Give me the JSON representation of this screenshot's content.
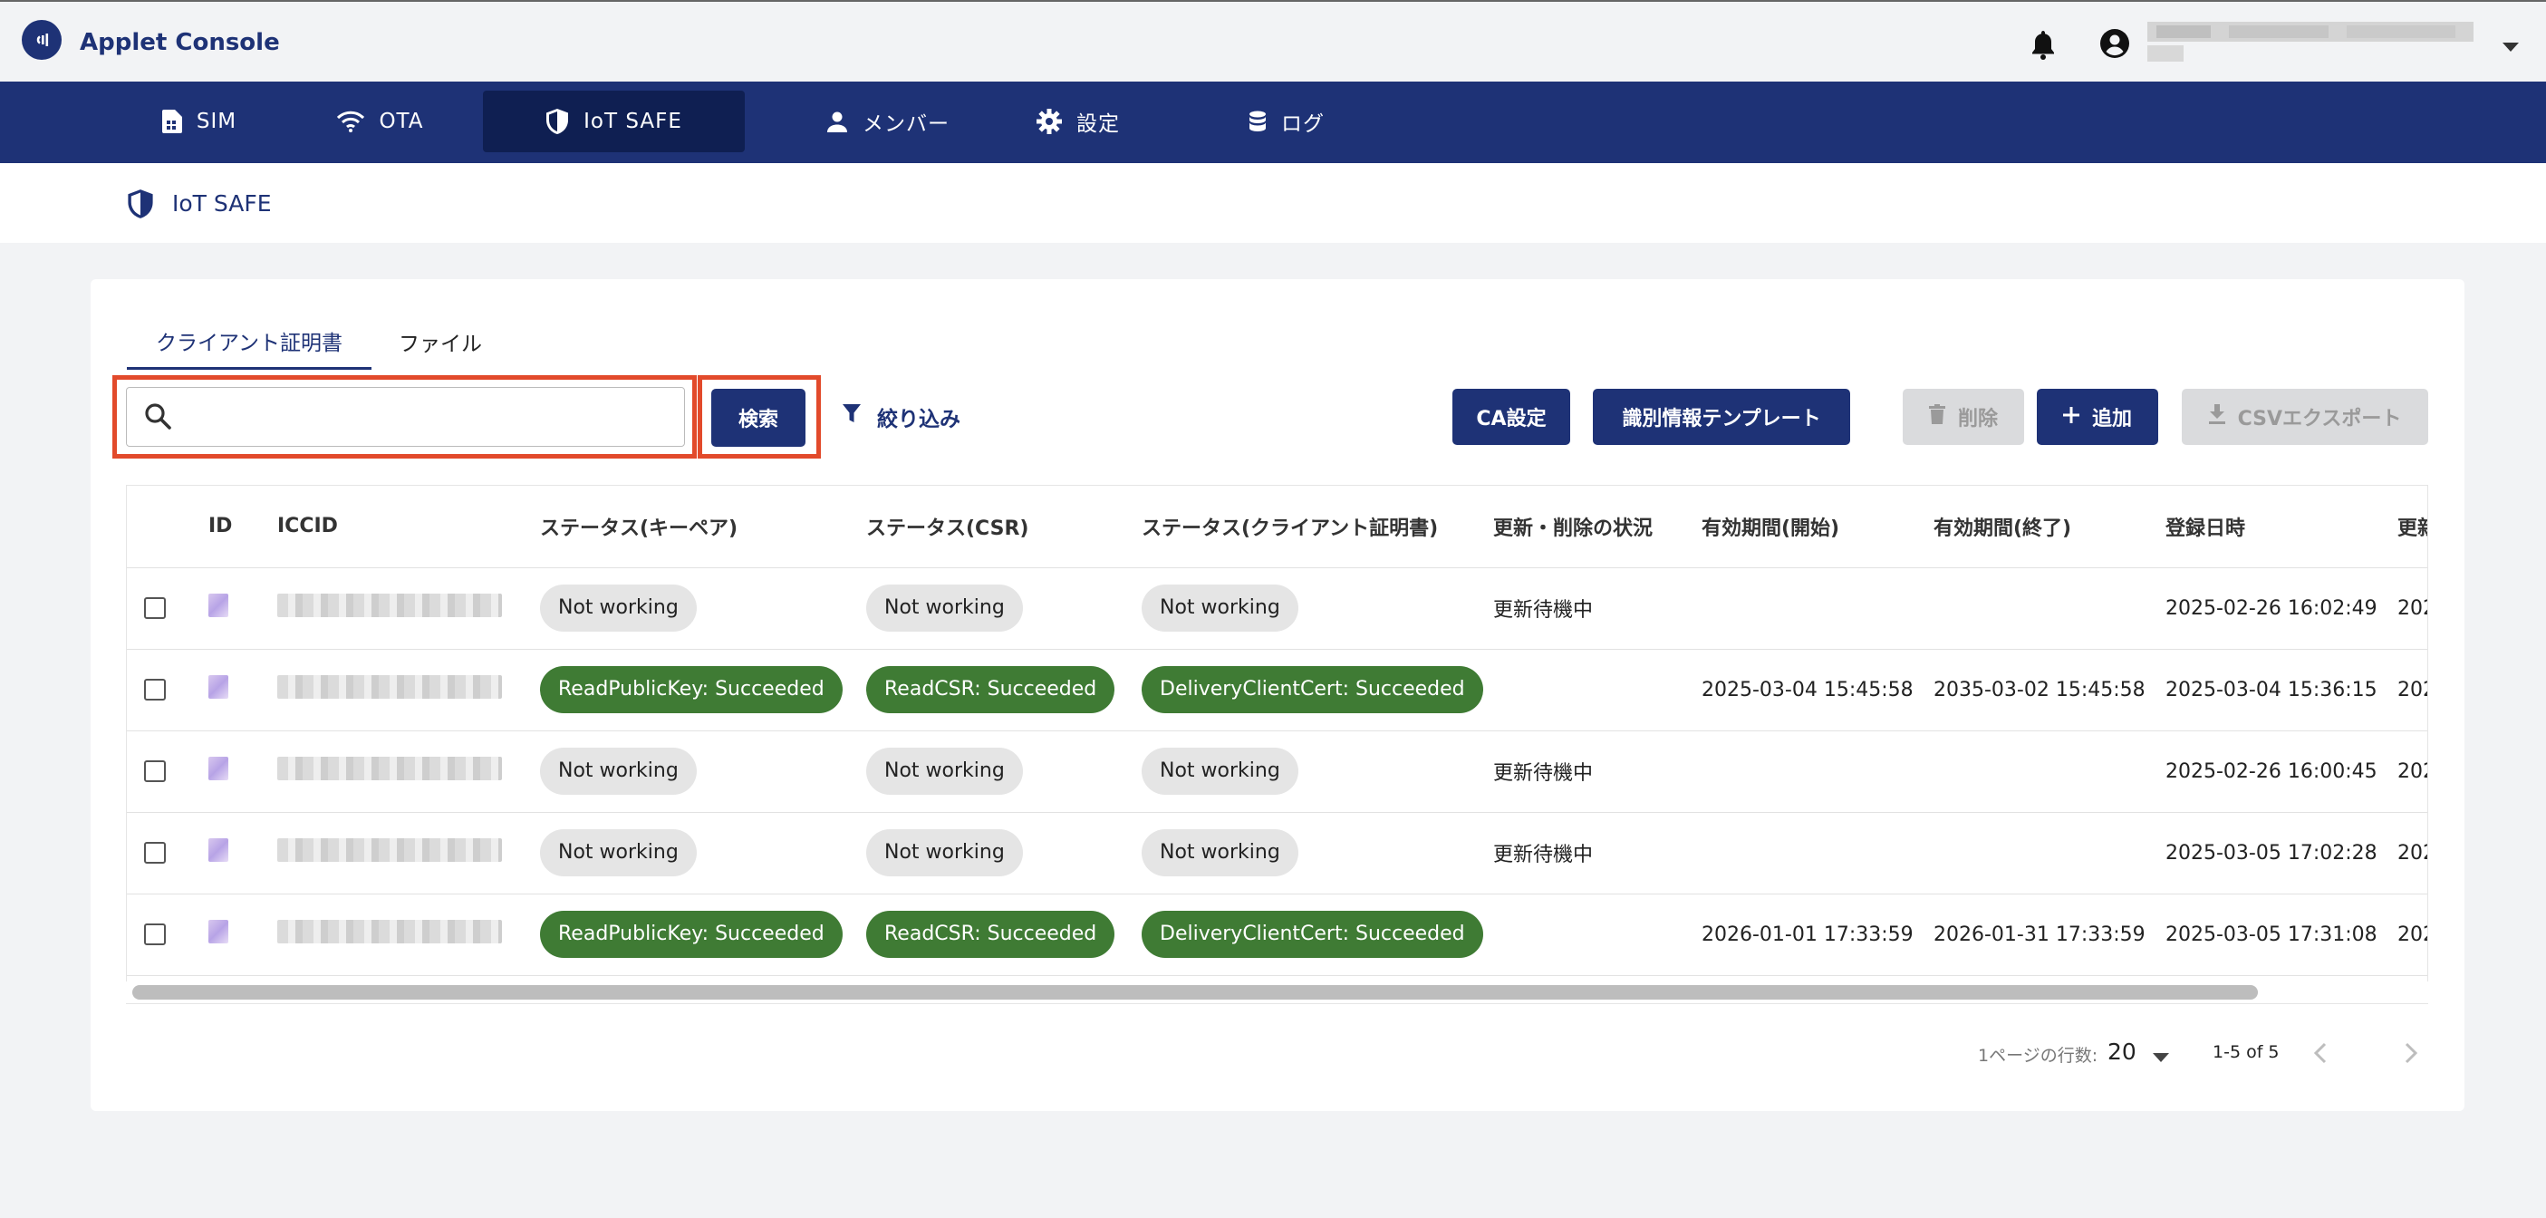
{
  "app": {
    "title": "Applet Console"
  },
  "nav": {
    "items": [
      {
        "label": "SIM",
        "icon": "sim-card-icon"
      },
      {
        "label": "OTA",
        "icon": "wifi-icon"
      },
      {
        "label": "IoT SAFE",
        "icon": "shield-icon",
        "active": true
      },
      {
        "label": "メンバー",
        "icon": "person-icon"
      },
      {
        "label": "設定",
        "icon": "gear-icon"
      },
      {
        "label": "ログ",
        "icon": "database-icon"
      }
    ]
  },
  "breadcrumb": {
    "title": "IoT SAFE"
  },
  "tabs": [
    {
      "label": "クライアント証明書",
      "active": true
    },
    {
      "label": "ファイル"
    }
  ],
  "search": {
    "placeholder": "",
    "value": "",
    "button_label": "検索"
  },
  "filter": {
    "label": "絞り込み"
  },
  "actions": {
    "ca_settings": "CA設定",
    "id_template": "識別情報テンプレート",
    "delete": "削除",
    "add": "追加",
    "csv_export": "CSVエクスポート"
  },
  "table": {
    "columns": [
      "ID",
      "ICCID",
      "ステータス(キーペア)",
      "ステータス(CSR)",
      "ステータス(クライアント証明書)",
      "更新・削除の状況",
      "有効期間(開始)",
      "有効期間(終了)",
      "登録日時",
      "更新"
    ],
    "rows": [
      {
        "keypair": "Not working",
        "csr": "Not working",
        "cert": "Not working",
        "renew": "更新待機中",
        "valid_from": "",
        "valid_to": "",
        "registered": "2025-02-26 16:02:49",
        "updated": "202"
      },
      {
        "keypair": "ReadPublicKey: Succeeded",
        "csr": "ReadCSR: Succeeded",
        "cert": "DeliveryClientCert: Succeeded",
        "renew": "",
        "valid_from": "2025-03-04 15:45:58",
        "valid_to": "2035-03-02 15:45:58",
        "registered": "2025-03-04 15:36:15",
        "updated": "202"
      },
      {
        "keypair": "Not working",
        "csr": "Not working",
        "cert": "Not working",
        "renew": "更新待機中",
        "valid_from": "",
        "valid_to": "",
        "registered": "2025-02-26 16:00:45",
        "updated": "202"
      },
      {
        "keypair": "Not working",
        "csr": "Not working",
        "cert": "Not working",
        "renew": "更新待機中",
        "valid_from": "",
        "valid_to": "",
        "registered": "2025-03-05 17:02:28",
        "updated": "202"
      },
      {
        "keypair": "ReadPublicKey: Succeeded",
        "csr": "ReadCSR: Succeeded",
        "cert": "DeliveryClientCert: Succeeded",
        "renew": "",
        "valid_from": "2026-01-01 17:33:59",
        "valid_to": "2026-01-31 17:33:59",
        "registered": "2025-03-05 17:31:08",
        "updated": "202"
      }
    ]
  },
  "pagination": {
    "rows_per_page_label": "1ページの行数:",
    "rows_per_page": "20",
    "range": "1-5 of 5"
  },
  "colors": {
    "brand": "#1e3276",
    "highlight": "#e24a2b",
    "success_chip": "#3f7b34",
    "neutral_chip": "#e5e5e5"
  }
}
